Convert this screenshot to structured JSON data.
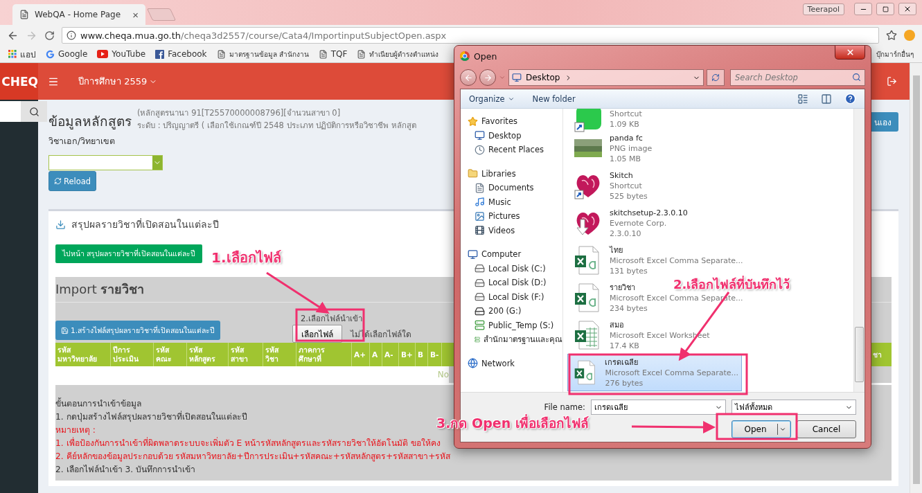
{
  "browser": {
    "tab": {
      "title": "WebQA - Home Page",
      "close": "×"
    },
    "user": "Teerapol",
    "url": {
      "host": "www.cheqa.mua.go.th",
      "path": "/cheqa3d2557/course/Cata4/ImportinputSubjectOpen.aspx"
    },
    "bookmarks": [
      {
        "kind": "apps",
        "label": "แอป"
      },
      {
        "kind": "google",
        "label": "Google"
      },
      {
        "kind": "youtube",
        "label": "YouTube"
      },
      {
        "kind": "facebook",
        "label": "Facebook"
      },
      {
        "kind": "page",
        "label": "มาตรฐานข้อมูล สำนักงาน"
      },
      {
        "kind": "page",
        "label": "TQF"
      },
      {
        "kind": "page",
        "label": "ทำเนียบผู้ดำรงตำแหน่ง"
      }
    ],
    "other_bookmarks": "บุ๊กมาร์กอื่นๆ"
  },
  "navbar": {
    "logo": "CHEQ",
    "year_menu": "ปีการศึกษา 2559"
  },
  "page": {
    "title": "ข้อมูลหลักสูตร",
    "meta": [
      "(หลักสูตรนานา 91[T25570000008796][จำนวนสาขา 0]",
      "ระดับ : ปริญญาตรี ( เลือกใช้เกณฑ์ปี 2548 ประเภท ปฏิบัติการหรือวิชาชีพ หลักสูต"
    ],
    "side_button": "นเอง",
    "campus_label": "วิชาเอก/วิทยาเขต",
    "reload_button": "Reload"
  },
  "panel": {
    "title": "สรุปผลรายวิชาที่เปิดสอนในแต่ละปี",
    "goto_button": "ไปหน้า สรุปผลรายวิชาที่เปิดสอนในแต่ละปี",
    "import_title": "Import **รายวิชา**",
    "create_button": "1.สร้างไฟล์สรุปผลรายวิชาที่เปิดสอนในแต่ละปี",
    "file_label": "2.เลือกไฟล์นำเข้า",
    "file_button": "เลือกไฟล์",
    "file_status": "ไม่ได้เลือกไฟล์ใด",
    "table": {
      "columns": [
        "รหัส\nมหาวิทยาลัย",
        "ปีการ\nประเมิน",
        "รหัส\nคณะ",
        "รหัส\nหลักสูตร",
        "รหัส\nสาขา",
        "รหัส\nวิชา",
        "ภาคการ\nศึกษาที่",
        "A+",
        "A",
        "A-",
        "B+",
        "B",
        "B-"
      ],
      "last_column": "ชา",
      "empty_text": "No"
    },
    "notes": [
      {
        "kind": "normal",
        "text": "ขั้นตอนการนำเข้าข้อมูล"
      },
      {
        "kind": "normal",
        "text": "1. กดปุ่มสร้างไฟล์สรุปผลรายวิชาที่เปิดสอนในแต่ละปี"
      },
      {
        "kind": "warning",
        "text": "หมายเหตุ :"
      },
      {
        "kind": "warning",
        "text": "1. เพื่อป้องกันการนำเข้าที่ผิดพลาดระบบจะเพิ่มตัว E หน้ารหัสหลักสูตรและรหัสรายวิชาให้อัตโนมัติ ขอให้คง"
      },
      {
        "kind": "warning",
        "text": "2. คีย์หลักของข้อมูลประกอบด้วย รหัสมหาวิทยาลัย+ปีการประเมิน+รหัสคณะ+รหัสหลักสูตร+รหัสสาขา+รหัส"
      },
      {
        "kind": "normal",
        "text": "2. เลือกไฟล์นำเข้า 3. บันทึกการนำเข้า"
      }
    ]
  },
  "dialog": {
    "title": "Open",
    "location": "Desktop",
    "search_placeholder": "Search Desktop",
    "toolbar": [
      {
        "label": "Organize",
        "kind": "menu"
      },
      {
        "label": "New folder",
        "kind": "plain"
      }
    ],
    "nav": [
      {
        "label": "Favorites",
        "kind": "favorites",
        "children": [
          {
            "label": "Desktop",
            "kind": "desktop"
          },
          {
            "label": "Recent Places",
            "kind": "recent"
          }
        ]
      },
      {
        "label": "Libraries",
        "kind": "libraries",
        "children": [
          {
            "label": "Documents",
            "kind": "documents"
          },
          {
            "label": "Music",
            "kind": "music"
          },
          {
            "label": "Pictures",
            "kind": "pictures"
          },
          {
            "label": "Videos",
            "kind": "videos"
          }
        ]
      },
      {
        "label": "Computer",
        "kind": "computer",
        "children": [
          {
            "label": "Local Disk (C:)",
            "kind": "disk"
          },
          {
            "label": "Local Disk (D:)",
            "kind": "disk"
          },
          {
            "label": "Local Disk (F:)",
            "kind": "disk"
          },
          {
            "label": "200 (G:)",
            "kind": "drive"
          },
          {
            "label": "Public_Temp (S:)",
            "kind": "network-drive"
          },
          {
            "label": "สำนักมาตรฐานและคุณ",
            "kind": "network-drive"
          }
        ]
      },
      {
        "label": "Network",
        "kind": "network"
      }
    ],
    "files": [
      {
        "kind": "chat-shortcut",
        "lines": [
          "Shortcut",
          "1.09 KB"
        ],
        "selected": false
      },
      {
        "kind": "image",
        "name": "panda fc",
        "lines": [
          "PNG image",
          "1.05 MB"
        ],
        "selected": false
      },
      {
        "kind": "heart-shortcut",
        "name": "Skitch",
        "lines": [
          "Shortcut",
          "525 bytes"
        ],
        "selected": false
      },
      {
        "kind": "heart-installer",
        "name": "skitchsetup-2.3.0.10",
        "lines": [
          "Evernote Corp.",
          "2.3.0.10"
        ],
        "selected": false
      },
      {
        "kind": "csv",
        "name": "ไทย",
        "lines": [
          "Microsoft Excel Comma Separate...",
          "131 bytes"
        ],
        "selected": false
      },
      {
        "kind": "csv",
        "name": "รายวิชา",
        "lines": [
          "Microsoft Excel Comma Separate...",
          "234 bytes"
        ],
        "selected": false
      },
      {
        "kind": "xlsx",
        "name": "สมอ",
        "lines": [
          "Microsoft Excel Worksheet",
          "17.4 KB"
        ],
        "selected": false
      },
      {
        "kind": "csv",
        "name": "เกรดเฉลีย",
        "lines": [
          "Microsoft Excel Comma Separate...",
          "276 bytes"
        ],
        "selected": true
      }
    ],
    "file_name_label": "File name:",
    "file_name": "เกรดเฉลีย",
    "file_type": "ไฟล์ทั้งหมด",
    "buttons": [
      {
        "label": "Open",
        "kind": "split"
      },
      {
        "label": "Cancel",
        "kind": "plain"
      }
    ]
  },
  "annotations": [
    "1.เลือกไฟล์",
    "2.เลือกไฟล์ที่บันทึกไว้",
    "3.กด Open เพื่อเลือกไฟล์"
  ]
}
